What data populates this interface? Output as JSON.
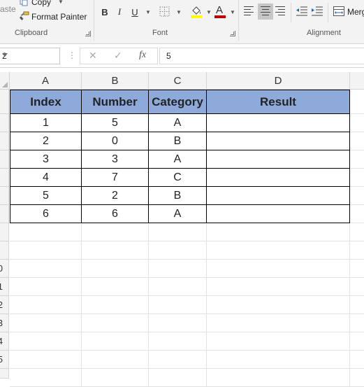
{
  "ribbon": {
    "clipboard": {
      "paste_label": "aste",
      "copy_label": "Copy",
      "format_painter_label": "Format Painter",
      "group_label": "Clipboard"
    },
    "font": {
      "bold": "B",
      "italic": "I",
      "underline": "U",
      "font_color_glyph": "A",
      "group_label": "Font",
      "fill_color": "#ffff00",
      "font_color": "#c00000"
    },
    "alignment": {
      "merge_label": "Merg",
      "group_label": "Alignment"
    }
  },
  "formula_bar": {
    "name_box": "2",
    "cancel_glyph": "✕",
    "enter_glyph": "✓",
    "fx_label": "fx",
    "value": "5"
  },
  "sheet": {
    "columns": [
      "A",
      "B",
      "C",
      "D"
    ],
    "row_numbers": [
      "0",
      "1",
      "2",
      "3",
      "4",
      "5"
    ],
    "table": {
      "headers": [
        "Index",
        "Number",
        "Category",
        "Result"
      ],
      "header_fill": "#8eaadb",
      "rows": [
        [
          "1",
          "5",
          "A",
          ""
        ],
        [
          "2",
          "0",
          "B",
          ""
        ],
        [
          "3",
          "3",
          "A",
          ""
        ],
        [
          "4",
          "7",
          "C",
          ""
        ],
        [
          "5",
          "2",
          "B",
          ""
        ],
        [
          "6",
          "6",
          "A",
          ""
        ]
      ]
    }
  }
}
